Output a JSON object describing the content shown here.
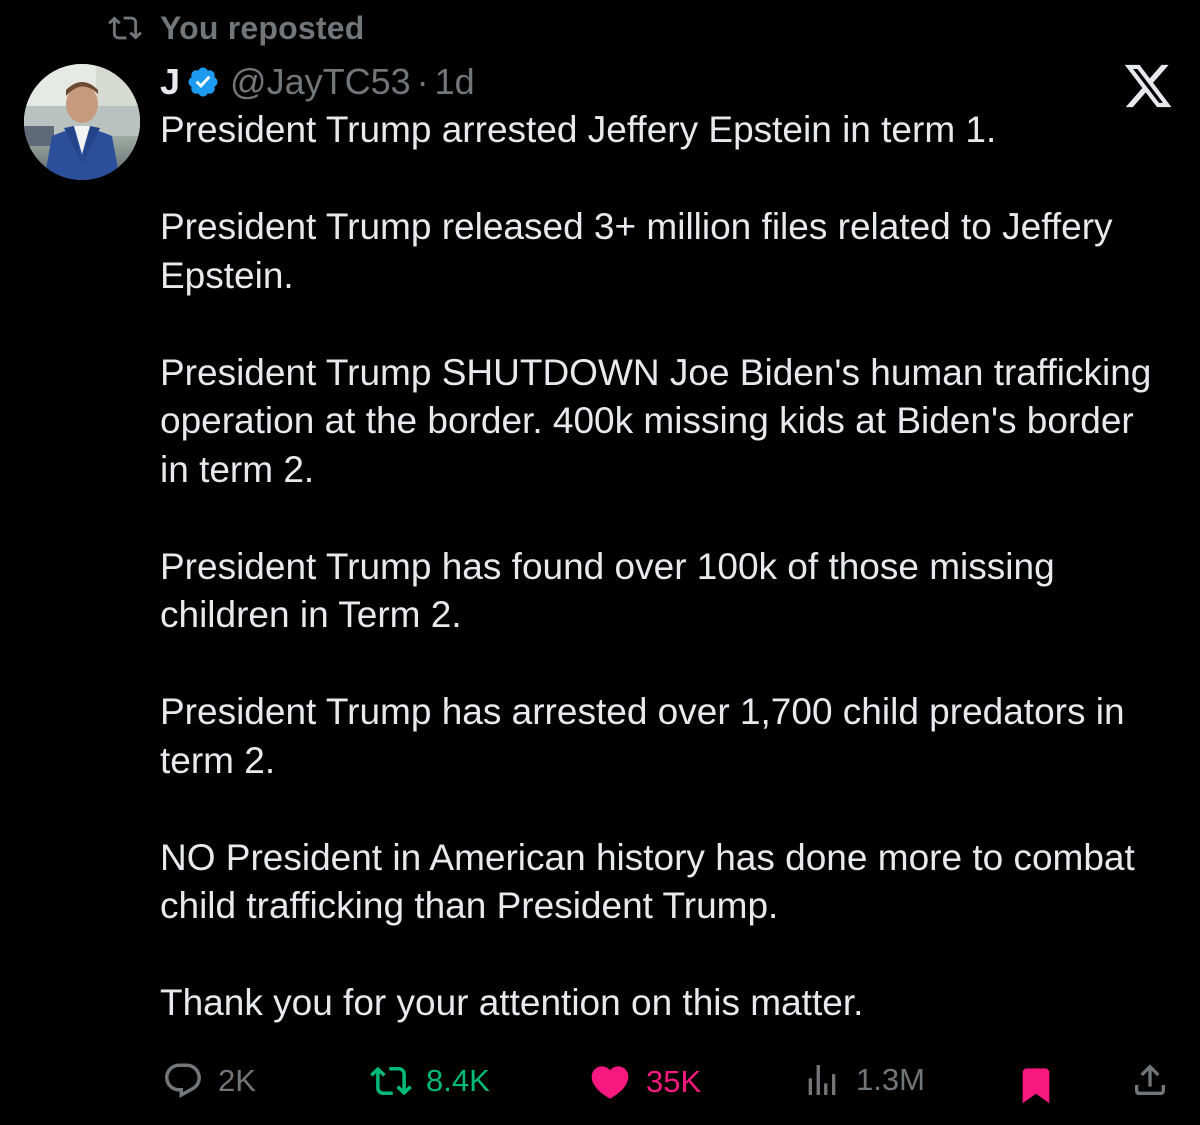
{
  "repost_banner": {
    "text": "You reposted",
    "icon": "repost-icon"
  },
  "author": {
    "name": "J",
    "verified": true,
    "handle": "@JayTC53",
    "separator": "·",
    "time": "1d"
  },
  "platform_logo": "X",
  "tweet": {
    "paragraphs": [
      "President Trump arrested Jeffery Epstein in term 1.",
      "President Trump released 3+ million files related to Jeffery Epstein.",
      "President Trump SHUTDOWN Joe Biden's human trafficking operation at the border. 400k missing kids at Biden's border in term 2.",
      "President Trump has found over 100k of those missing children in Term 2.",
      "President Trump has arrested over 1,700 child predators in term 2.",
      "NO President in American history has done more to combat child trafficking than President Trump.",
      "Thank you for your attention on this matter."
    ]
  },
  "actions": {
    "replies": "2K",
    "reposts": "8.4K",
    "likes": "35K",
    "views": "1.3M"
  },
  "colors": {
    "background": "#000000",
    "text": "#e7e9ea",
    "muted": "#71767b",
    "verified": "#1d9bf0",
    "repost_active": "#00ba7c",
    "like_active": "#f91880",
    "bookmark_active": "#f91880"
  }
}
